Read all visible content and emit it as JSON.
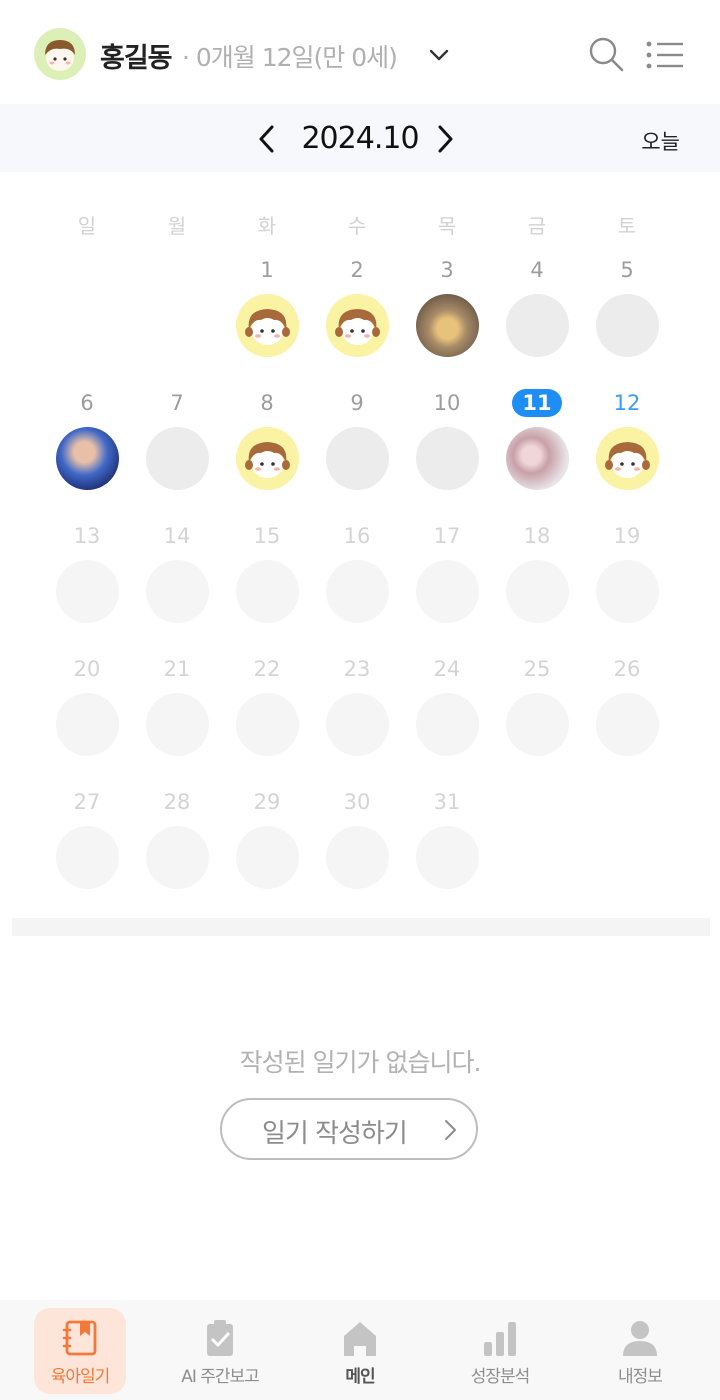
{
  "header": {
    "child_name": "홍길동",
    "child_age": "· 0개월 12일(만 0세)"
  },
  "month_bar": {
    "month": "2024.10",
    "today_label": "오늘"
  },
  "calendar": {
    "weekdays": [
      "일",
      "월",
      "화",
      "수",
      "목",
      "금",
      "토"
    ],
    "weeks": [
      [
        {
          "day": ""
        },
        {
          "day": ""
        },
        {
          "day": "1",
          "thumb": "character"
        },
        {
          "day": "2",
          "thumb": "character"
        },
        {
          "day": "3",
          "thumb": "photo"
        },
        {
          "day": "4",
          "thumb": "empty"
        },
        {
          "day": "5",
          "thumb": "empty"
        }
      ],
      [
        {
          "day": "6",
          "thumb": "photo"
        },
        {
          "day": "7",
          "thumb": "empty"
        },
        {
          "day": "8",
          "thumb": "character"
        },
        {
          "day": "9",
          "thumb": "empty"
        },
        {
          "day": "10",
          "thumb": "empty"
        },
        {
          "day": "11",
          "thumb": "photo",
          "state": "today"
        },
        {
          "day": "12",
          "thumb": "character",
          "state": "selected"
        }
      ],
      [
        {
          "day": "13",
          "state": "future"
        },
        {
          "day": "14",
          "state": "future"
        },
        {
          "day": "15",
          "state": "future"
        },
        {
          "day": "16",
          "state": "future"
        },
        {
          "day": "17",
          "state": "future"
        },
        {
          "day": "18",
          "state": "future"
        },
        {
          "day": "19",
          "state": "future"
        }
      ],
      [
        {
          "day": "20",
          "state": "future"
        },
        {
          "day": "21",
          "state": "future"
        },
        {
          "day": "22",
          "state": "future"
        },
        {
          "day": "23",
          "state": "future"
        },
        {
          "day": "24",
          "state": "future"
        },
        {
          "day": "25",
          "state": "future"
        },
        {
          "day": "26",
          "state": "future"
        }
      ],
      [
        {
          "day": "27",
          "state": "future"
        },
        {
          "day": "28",
          "state": "future"
        },
        {
          "day": "29",
          "state": "future"
        },
        {
          "day": "30",
          "state": "future"
        },
        {
          "day": "31",
          "state": "future"
        }
      ]
    ]
  },
  "diary": {
    "empty_message": "작성된 일기가 없습니다.",
    "write_button": "일기 작성하기"
  },
  "nav": {
    "items": [
      {
        "label": "육아일기",
        "icon": "diary-icon",
        "active": true
      },
      {
        "label": "AI 주간보고",
        "icon": "clipboard-check-icon"
      },
      {
        "label": "메인",
        "icon": "home-icon"
      },
      {
        "label": "성장분석",
        "icon": "bar-chart-icon"
      },
      {
        "label": "내정보",
        "icon": "person-icon"
      }
    ]
  },
  "colors": {
    "accent_blue": "#1e8ef5",
    "accent_orange": "#f2793a",
    "character_yellow": "#fbf3a4",
    "avatar_green": "#dcefb6"
  }
}
